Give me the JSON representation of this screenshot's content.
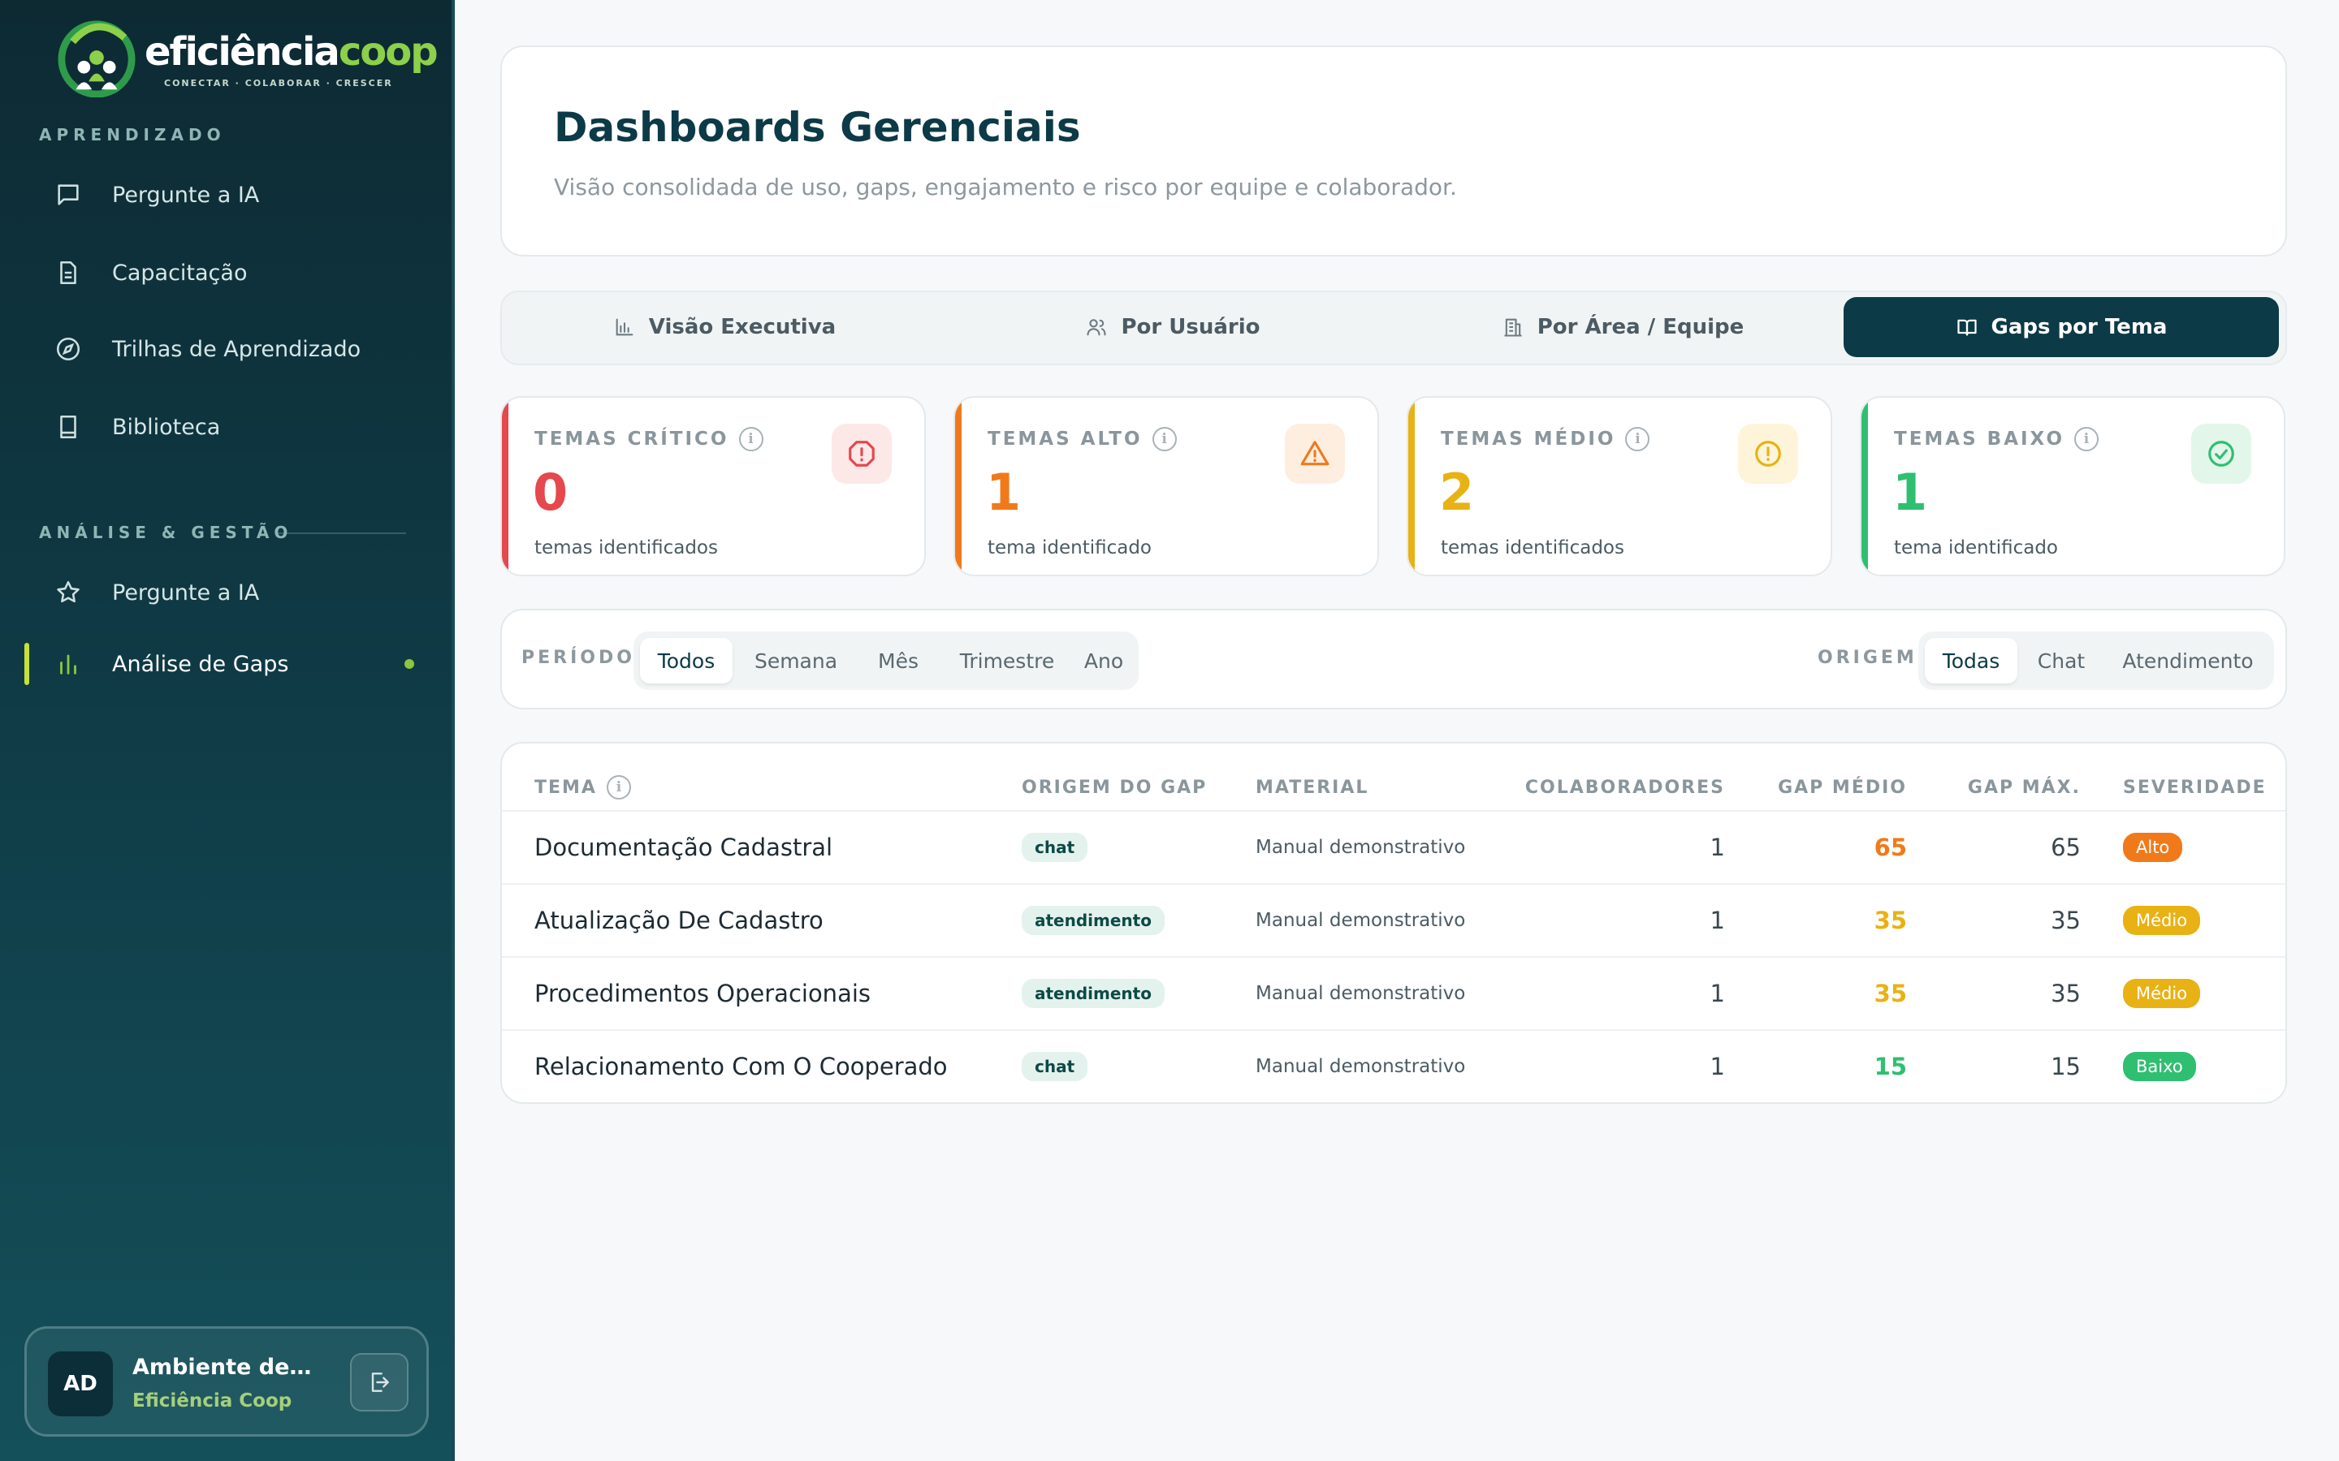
{
  "brand": {
    "name_main": "eficiência",
    "name_accent": "coop",
    "tagline": "CONECTAR · COLABORAR · CRESCER"
  },
  "sidebar": {
    "section_learning": "APRENDIZADO",
    "learning_items": [
      {
        "label": "Pergunte a IA",
        "icon": "chat-icon"
      },
      {
        "label": "Capacitação",
        "icon": "document-icon"
      },
      {
        "label": "Trilhas de Aprendizado",
        "icon": "compass-icon"
      },
      {
        "label": "Biblioteca",
        "icon": "book-icon"
      }
    ],
    "section_management": "ANÁLISE & GESTÃO",
    "management_items": [
      {
        "label": "Pergunte a IA",
        "icon": "star-icon"
      },
      {
        "label": "Análise de Gaps",
        "icon": "bar-chart-icon",
        "active": true
      }
    ],
    "user": {
      "initials": "AD",
      "name": "Ambiente demonstração",
      "org": "Eficiência Coop"
    }
  },
  "header": {
    "title": "Dashboards Gerenciais",
    "subtitle": "Visão consolidada de uso, gaps, engajamento e risco por equipe e colaborador."
  },
  "tabs": [
    {
      "label": "Visão Executiva",
      "icon": "bar-chart-icon"
    },
    {
      "label": "Por Usuário",
      "icon": "users-icon"
    },
    {
      "label": "Por Área / Equipe",
      "icon": "building-icon"
    },
    {
      "label": "Gaps por Tema",
      "icon": "open-book-icon",
      "active": true
    }
  ],
  "stats": [
    {
      "label": "TEMAS CRÍTICO",
      "value": "0",
      "desc": "temas identificados",
      "color": "#e5484d",
      "icon": "alert-octagon-icon"
    },
    {
      "label": "TEMAS ALTO",
      "value": "1",
      "desc": "tema identificado",
      "color": "#f07a1a",
      "icon": "warning-triangle-icon"
    },
    {
      "label": "TEMAS MÉDIO",
      "value": "2",
      "desc": "temas identificados",
      "color": "#e8b214",
      "icon": "alert-circle-icon"
    },
    {
      "label": "TEMAS BAIXO",
      "value": "1",
      "desc": "tema identificado",
      "color": "#2fbf71",
      "icon": "check-circle-icon"
    }
  ],
  "filters": {
    "period_label": "PERÍODO",
    "period_options": [
      "Todos",
      "Semana",
      "Mês",
      "Trimestre",
      "Ano"
    ],
    "period_selected": "Todos",
    "origin_label": "ORIGEM",
    "origin_options": [
      "Todas",
      "Chat",
      "Atendimento"
    ],
    "origin_selected": "Todas"
  },
  "table": {
    "columns": [
      "TEMA",
      "ORIGEM DO GAP",
      "MATERIAL",
      "COLABORADORES",
      "GAP MÉDIO",
      "GAP MÁX.",
      "SEVERIDADE"
    ],
    "rows": [
      {
        "tema": "Documentação Cadastral",
        "origem": "chat",
        "material": "Manual demonstrativo",
        "colaboradores": "1",
        "gap_medio": "65",
        "gap_max": "65",
        "severidade": "Alto",
        "color": "#f07a1a"
      },
      {
        "tema": "Atualização De Cadastro",
        "origem": "atendimento",
        "material": "Manual demonstrativo",
        "colaboradores": "1",
        "gap_medio": "35",
        "gap_max": "35",
        "severidade": "Médio",
        "color": "#e8b214"
      },
      {
        "tema": "Procedimentos Operacionais",
        "origem": "atendimento",
        "material": "Manual demonstrativo",
        "colaboradores": "1",
        "gap_medio": "35",
        "gap_max": "35",
        "severidade": "Médio",
        "color": "#e8b214"
      },
      {
        "tema": "Relacionamento Com O Cooperado",
        "origem": "chat",
        "material": "Manual demonstrativo",
        "colaboradores": "1",
        "gap_medio": "15",
        "gap_max": "15",
        "severidade": "Baixo",
        "color": "#2fbf71"
      }
    ]
  }
}
